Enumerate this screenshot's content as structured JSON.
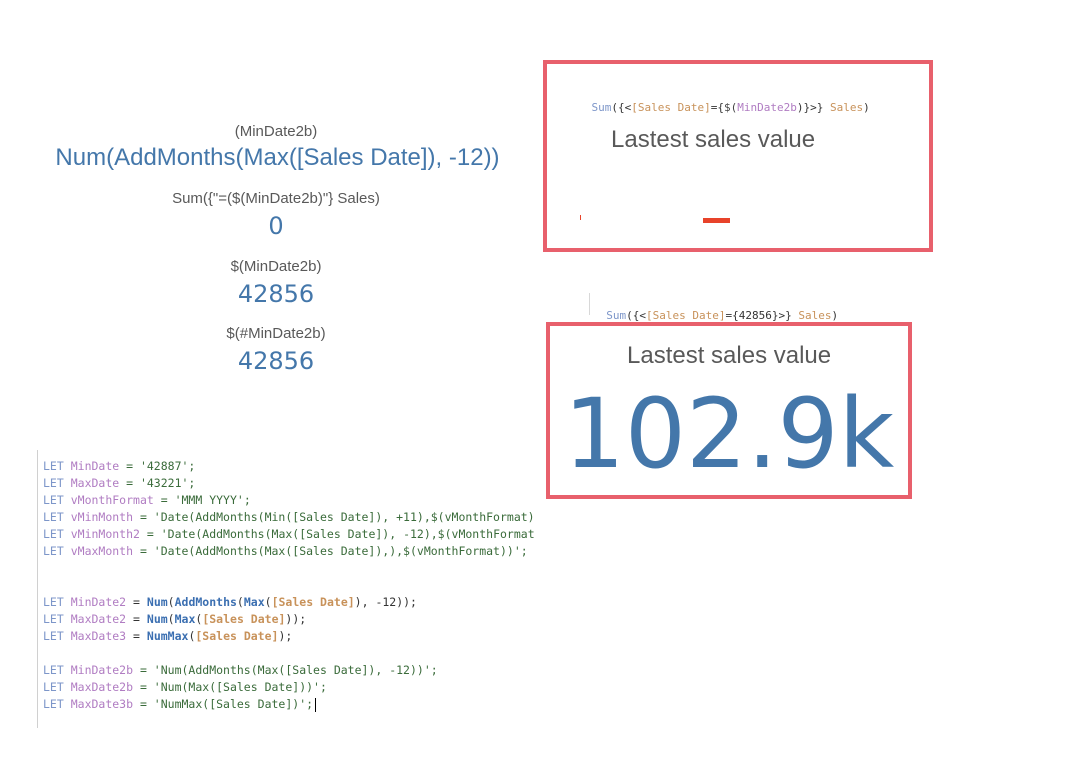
{
  "left_panel": {
    "label1": "(MinDate2b)",
    "value1": "Num(AddMonths(Max([Sales Date]), -12))",
    "label2": "Sum({\"=($(MinDate2b)\"} Sales)",
    "value2": "0",
    "label3": "$(MinDate2b)",
    "value3": "42856",
    "label4": "$(#MinDate2b)",
    "value4": "42856"
  },
  "kpi_top": {
    "expr_sum": "Sum",
    "expr_open": "({<",
    "expr_field": "[Sales Date]",
    "expr_eq": "={",
    "expr_dollar": "$(",
    "expr_var": "MinDate2b",
    "expr_close": ")}>} ",
    "expr_measure": "Sales",
    "expr_end": ")",
    "title": "Lastest sales value"
  },
  "kpi_bottom": {
    "expr_sum": "Sum",
    "expr_open": "({<",
    "expr_field": "[Sales Date]",
    "expr_eq": "={42856}>} ",
    "expr_measure": "Sales",
    "expr_end": ")",
    "title": "Lastest sales value",
    "value": "102.9k"
  },
  "script": {
    "let": "LET",
    "l1_var": "MinDate",
    "l1_rest": " = '42887';",
    "l2_var": "MaxDate",
    "l2_rest": " = '43221';",
    "l3_var": "vMonthFormat",
    "l3_rest": " = 'MMM YYYY';",
    "l4_var": "vMinMonth",
    "l4_rest": " = 'Date(AddMonths(Min([Sales Date]), +11),$(vMonthFormat)",
    "l5_var": "vMinMonth2",
    "l5_rest": " = 'Date(AddMonths(Max([Sales Date]), -12),$(vMonthFormat",
    "l6_var": "vMaxMonth",
    "l6_rest": " = 'Date(AddMonths(Max([Sales Date]),),$(vMonthFormat))';",
    "l7_var": "MinDate2",
    "l7_eq": " = ",
    "l7_fn1": "Num",
    "l7_p1": "(",
    "l7_fn2": "AddMonths",
    "l7_p2": "(",
    "l7_fn3": "Max",
    "l7_p3": "(",
    "l7_field": "[Sales Date]",
    "l7_rest": "), -12));",
    "l8_var": "MaxDate2",
    "l8_eq": " = ",
    "l8_fn1": "Num",
    "l8_p1": "(",
    "l8_fn2": "Max",
    "l8_p2": "(",
    "l8_field": "[Sales Date]",
    "l8_rest": "));",
    "l9_var": "MaxDate3",
    "l9_eq": " = ",
    "l9_fn1": "NumMax",
    "l9_p1": "(",
    "l9_field": "[Sales Date]",
    "l9_rest": ");",
    "l10_var": "MinDate2b",
    "l10_rest": " = 'Num(AddMonths(Max([Sales Date]), -12))';",
    "l11_var": "MaxDate2b",
    "l11_rest": " = 'Num(Max([Sales Date]))';",
    "l12_var": "MaxDate3b",
    "l12_rest": " = 'NumMax([Sales Date])';"
  },
  "colors": {
    "value_blue": "#4477aa",
    "highlight_red": "#e8606c",
    "bar_red": "#e8432a"
  }
}
